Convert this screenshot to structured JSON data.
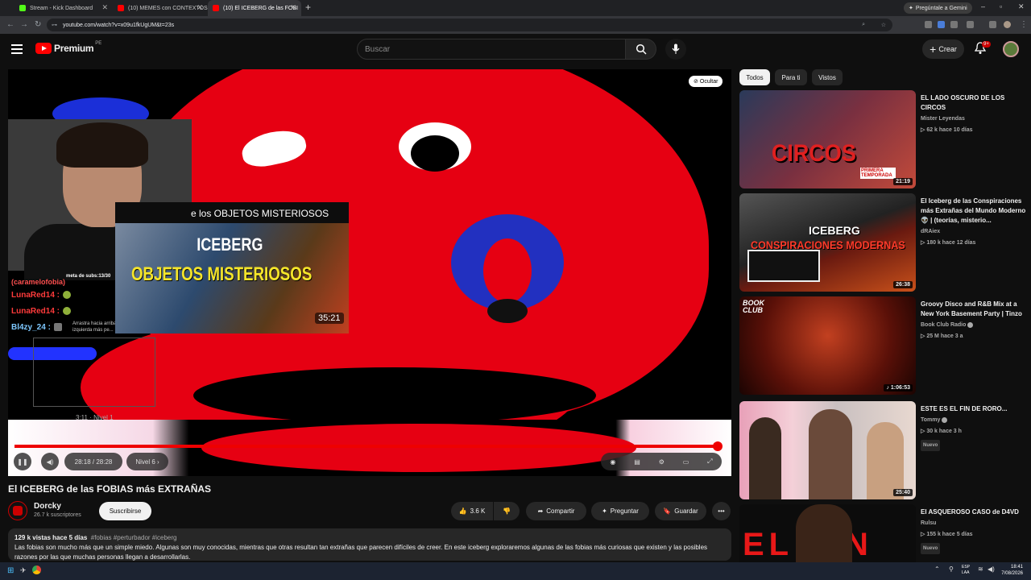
{
  "browser": {
    "tabs": [
      {
        "title": "Stream - Kick Dashboard",
        "color": "#53fc18"
      },
      {
        "title": "(10) MEMES con CONTEXTOS",
        "color": "#ff0000"
      },
      {
        "title": "(10) El ICEBERG de las FOBI",
        "color": "#ff0000"
      }
    ],
    "gemini_label": "Pregúntale a Gemini",
    "url": "youtube.com/watch?v=x09u1fkUgUM&t=23s"
  },
  "yt": {
    "logo_text": "Premium",
    "logo_region": "PE",
    "search_placeholder": "Buscar",
    "create_label": "Crear",
    "notif_count": "9+"
  },
  "player": {
    "hide_label": "Ocultar",
    "meta_subs": "meta de subs:13/30",
    "chat_partial": "(caramelofobia)",
    "chat": [
      {
        "user": "LunaRed14 :"
      },
      {
        "user": "LunaRed14 :"
      },
      {
        "user": "Bl4zy_24 :"
      }
    ],
    "chat_hint": "Arrastra hacia arriba para izquierda más pe...",
    "card_title": "e los OBJETOS MISTERIOSOS",
    "card_iceberg": "ICEBERG",
    "card_objects": "OBJETOS MISTERIOSOS",
    "card_duration": "35:21",
    "scrub_label": "3:11 · Nivel 1",
    "time": "28:18 / 28:28",
    "chapter": "Nivel 6",
    "progress": 0.99
  },
  "video": {
    "title": "El ICEBERG de las FOBIAS más EXTRAÑAS",
    "channel": "Dorcky",
    "subs": "26.7 k suscriptores",
    "subscribe": "Suscribirse",
    "likes": "3.6 K",
    "share": "Compartir",
    "ask": "Preguntar",
    "save": "Guardar",
    "stats": "129 k vistas  hace 5 días",
    "tags": "#fobias #perturbador #iceberg",
    "description": "Las fobias son mucho más que un simple miedo. Algunas son muy conocidas, mientras que otras resultan tan extrañas que parecen difíciles de creer. En este iceberg exploraremos algunas de las fobias más curiosas que existen y las posibles razones por las que muchas personas llegan a desarrollarlas."
  },
  "chips": [
    "Todos",
    "Para ti",
    "Vistos"
  ],
  "recs": [
    {
      "title": "EL LADO OSCURO DE LOS CIRCOS",
      "channel": "Mister Leyendas",
      "views": "▷ 62 k  hace 10 días",
      "duration": "21:19",
      "thumb_text": "CIRCOS",
      "thumb_extra": "PRIMERA TEMPORADA",
      "verified": false,
      "tag": ""
    },
    {
      "title": "El Iceberg de las Conspiraciones más Extrañas del Mundo Moderno 👽 | (teorías, misterio...",
      "channel": "dRAiex",
      "views": "▷ 180 k  hace 12 días",
      "duration": "26:38",
      "thumb_text": "CONSPIRACIONES MODERNAS",
      "thumb_extra": "ICEBERG",
      "verified": false,
      "tag": ""
    },
    {
      "title": "Groovy Disco and R&B Mix at a New York Basement Party | Tinzo",
      "channel": "Book Club Radio",
      "views": "▷ 25 M  hace 3 a",
      "duration": "♪ 1:06:53",
      "thumb_text": "BOOK CLUB",
      "thumb_extra": "",
      "verified": true,
      "tag": ""
    },
    {
      "title": "ESTE ES EL FIN DE RORO...",
      "channel": "Tommy",
      "views": "▷ 30 k  hace 3 h",
      "duration": "25:40",
      "thumb_text": "",
      "thumb_extra": "",
      "verified": true,
      "tag": "Nuevo"
    },
    {
      "title": "El ASQUEROSO CASO de D4VD",
      "channel": "Rulsu",
      "views": "▷ 155 k  hace 5 días",
      "duration": "",
      "thumb_text": "EL FIN",
      "thumb_extra": "",
      "verified": false,
      "tag": "Nuevo"
    }
  ],
  "taskbar": {
    "lang1": "ESP",
    "lang2": "LAA",
    "time": "18:41",
    "date": "7/08/2026"
  }
}
